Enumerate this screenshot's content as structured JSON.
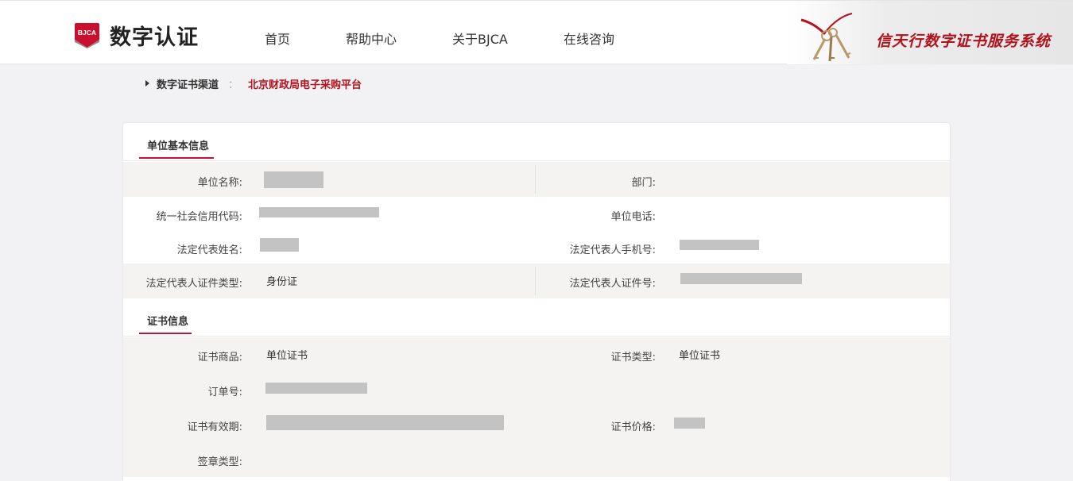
{
  "header": {
    "logo_badge_text": "BJCA",
    "logo_text": "数字认证",
    "nav": [
      "首页",
      "帮助中心",
      "关于BJCA",
      "在线咨询"
    ],
    "banner_text": "信天行数字证书服务系统"
  },
  "breadcrumb": {
    "label": "数字证书渠道",
    "separator": "：",
    "value": "北京财政局电子采购平台"
  },
  "basic_info": {
    "title": "单位基本信息",
    "unit_name_label": "单位名称:",
    "department_label": "部门:",
    "credit_code_label": "统一社会信用代码:",
    "unit_phone_label": "单位电话:",
    "legal_rep_name_label": "法定代表姓名:",
    "legal_rep_mobile_label": "法定代表人手机号:",
    "legal_rep_id_type_label": "法定代表人证件类型:",
    "legal_rep_id_type_value": "身份证",
    "legal_rep_id_no_label": "法定代表人证件号:"
  },
  "cert_info": {
    "title": "证书信息",
    "product_label": "证书商品:",
    "product_value": "单位证书",
    "type_label": "证书类型:",
    "type_value": "单位证书",
    "order_no_label": "订单号:",
    "validity_label": "证书有效期:",
    "price_label": "证书价格:",
    "seal_type_label": "签章类型:"
  },
  "colors": {
    "accent": "#c2123a",
    "brand_red": "#b1121c",
    "page_bg": "#f2f2f4",
    "row_gray": "#f4f3f2",
    "redaction": "#c3c3c3"
  }
}
